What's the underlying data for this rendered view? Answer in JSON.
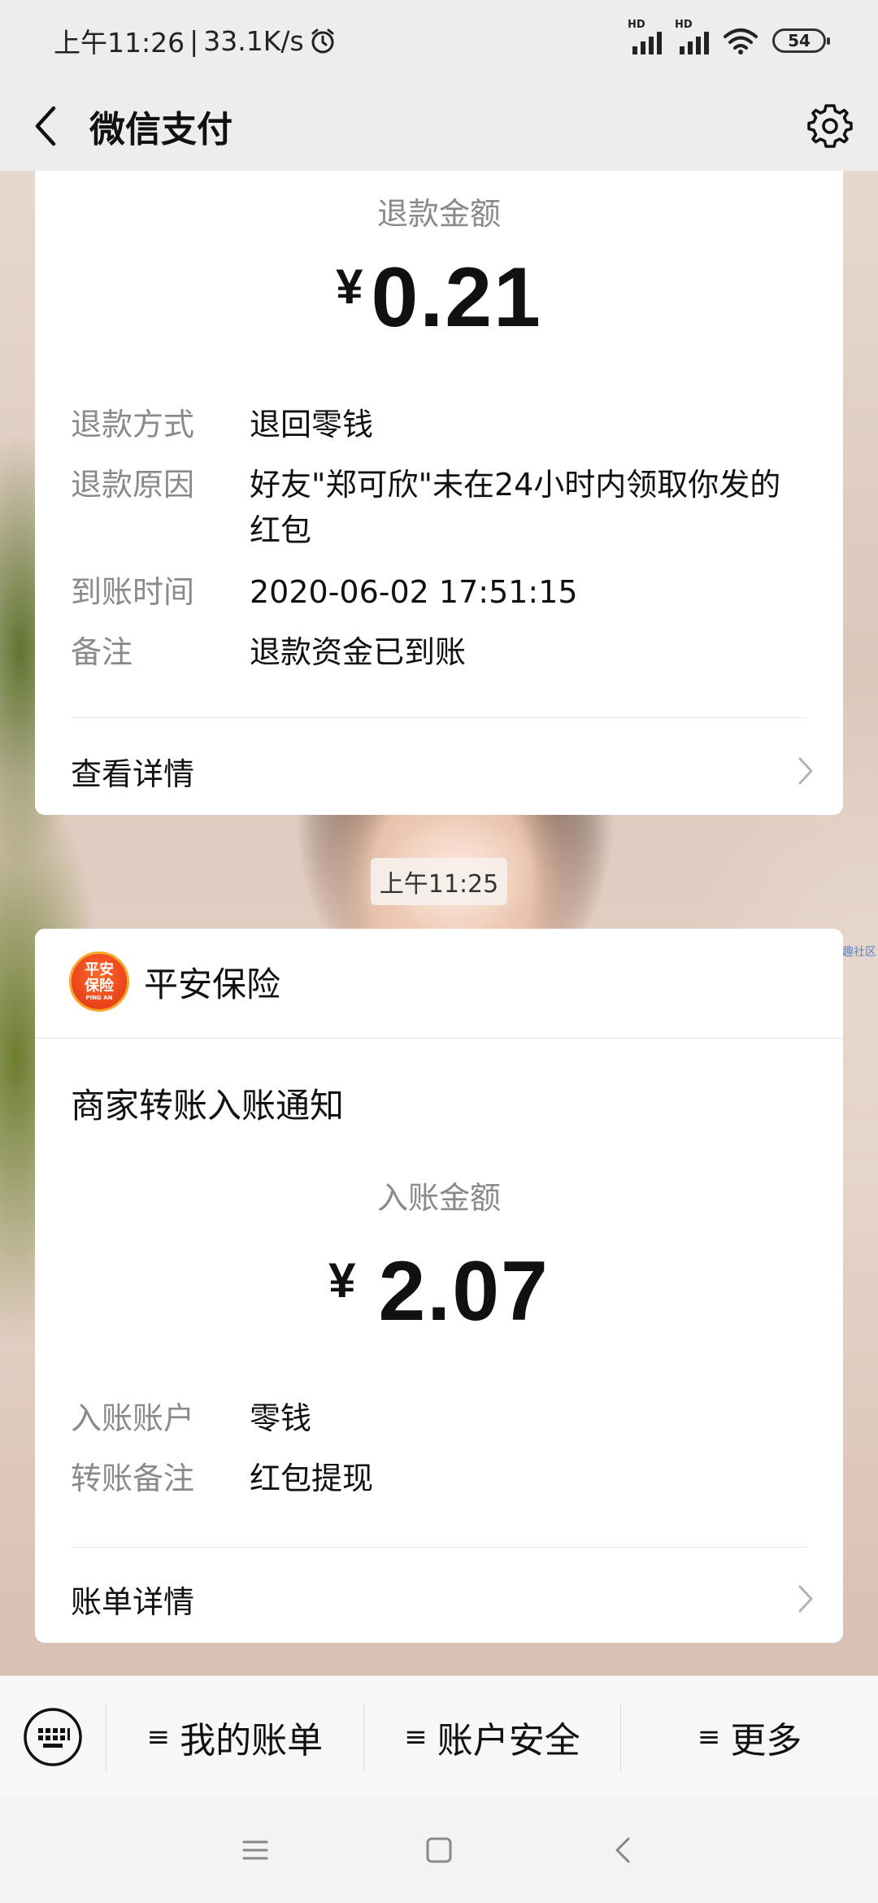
{
  "status_bar": {
    "time": "上午11:26",
    "net_speed": "33.1K/s",
    "signal_label": "HD",
    "battery": "54"
  },
  "header": {
    "title": "微信支付"
  },
  "refund_card": {
    "amount_label": "退款金额",
    "currency": "¥",
    "amount": "0.21",
    "rows": [
      {
        "key": "退款方式",
        "value": "退回零钱"
      },
      {
        "key": "退款原因",
        "value": "好友\"郑可欣\"未在24小时内领取你发的红包"
      },
      {
        "key": "到账时间",
        "value": "2020-06-02 17:51:15"
      },
      {
        "key": "备注",
        "value": "退款资金已到账"
      }
    ],
    "detail_label": "查看详情"
  },
  "timestamp": "上午11:25",
  "transfer_card": {
    "merchant_logo_line1": "平安",
    "merchant_logo_line2": "保险",
    "merchant_logo_sub": "PING AN",
    "merchant_name": "平安保险",
    "notice_title": "商家转账入账通知",
    "amount_label": "入账金额",
    "currency": "¥",
    "amount": "2.07",
    "rows": [
      {
        "key": "入账账户",
        "value": "零钱"
      },
      {
        "key": "转账备注",
        "value": "红包提现"
      }
    ],
    "detail_label": "账单详情"
  },
  "watermark": "搞趣社区",
  "menu": {
    "items": [
      {
        "label": "我的账单"
      },
      {
        "label": "账户安全"
      },
      {
        "label": "更多"
      }
    ]
  },
  "colors": {
    "chrome_bg": "#ededed",
    "card_bg": "#ffffff",
    "muted_text": "#8a8a8a",
    "logo_orange": "#e8421b"
  }
}
